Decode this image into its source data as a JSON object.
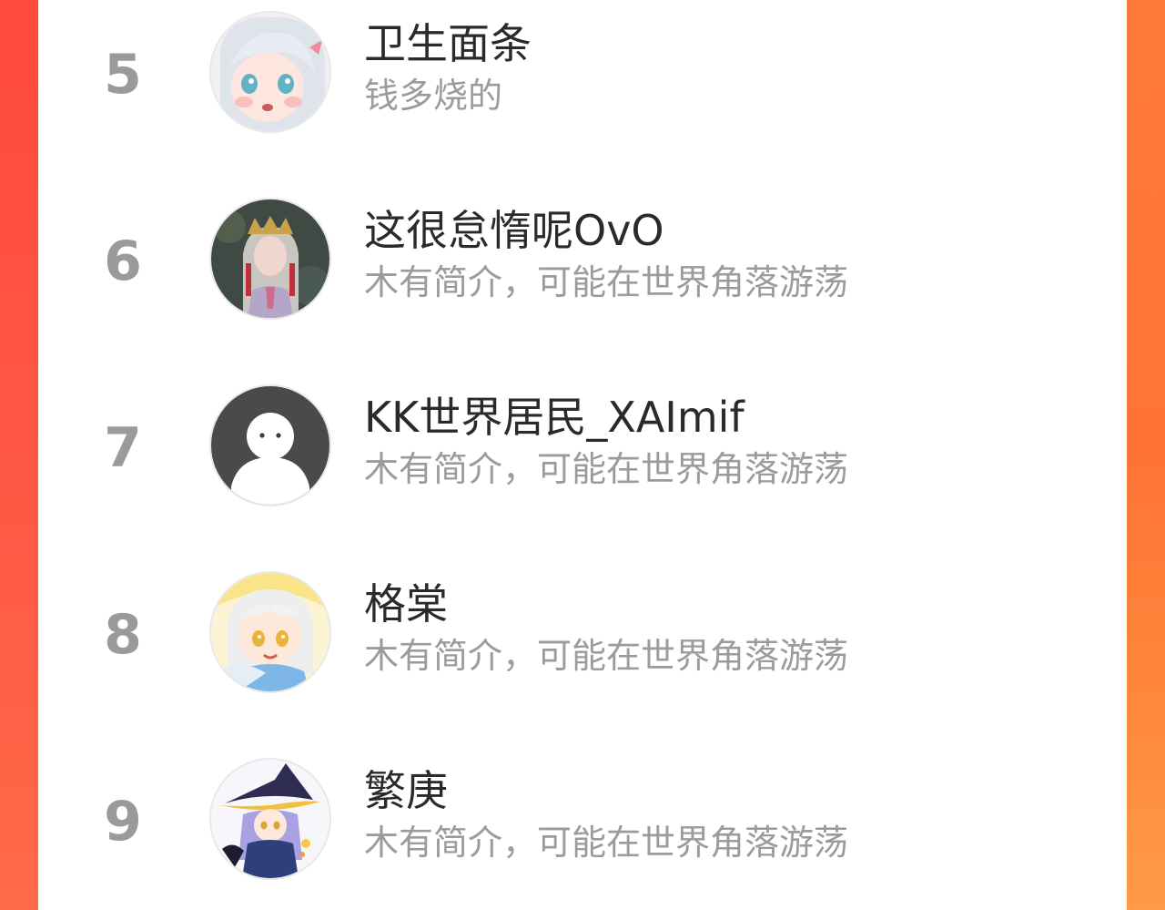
{
  "ranking": {
    "items": [
      {
        "rank": "5",
        "name": "卫生面条",
        "bio": "钱多烧的",
        "avatar_icon": "anime-girl-avatar-icon"
      },
      {
        "rank": "6",
        "name": "这很怠惰呢OvO",
        "bio": "木有简介，可能在世界角落游荡",
        "avatar_icon": "cosplay-photo-avatar-icon"
      },
      {
        "rank": "7",
        "name": "KK世界居民_XAImif",
        "bio": "木有简介，可能在世界角落游荡",
        "avatar_icon": "default-ghost-avatar-icon"
      },
      {
        "rank": "8",
        "name": "格棠",
        "bio": "木有简介，可能在世界角落游荡",
        "avatar_icon": "anime-boy-avatar-icon"
      },
      {
        "rank": "9",
        "name": "繁庚",
        "bio": "木有简介，可能在世界角落游荡",
        "avatar_icon": "witch-girl-avatar-icon"
      }
    ]
  },
  "colors": {
    "accent_left": "#ff4a3e",
    "accent_right": "#ff7a3a",
    "rank_number": "#9a9a9a",
    "name_text": "#2a2a2a",
    "bio_text": "#9b9b9b"
  }
}
